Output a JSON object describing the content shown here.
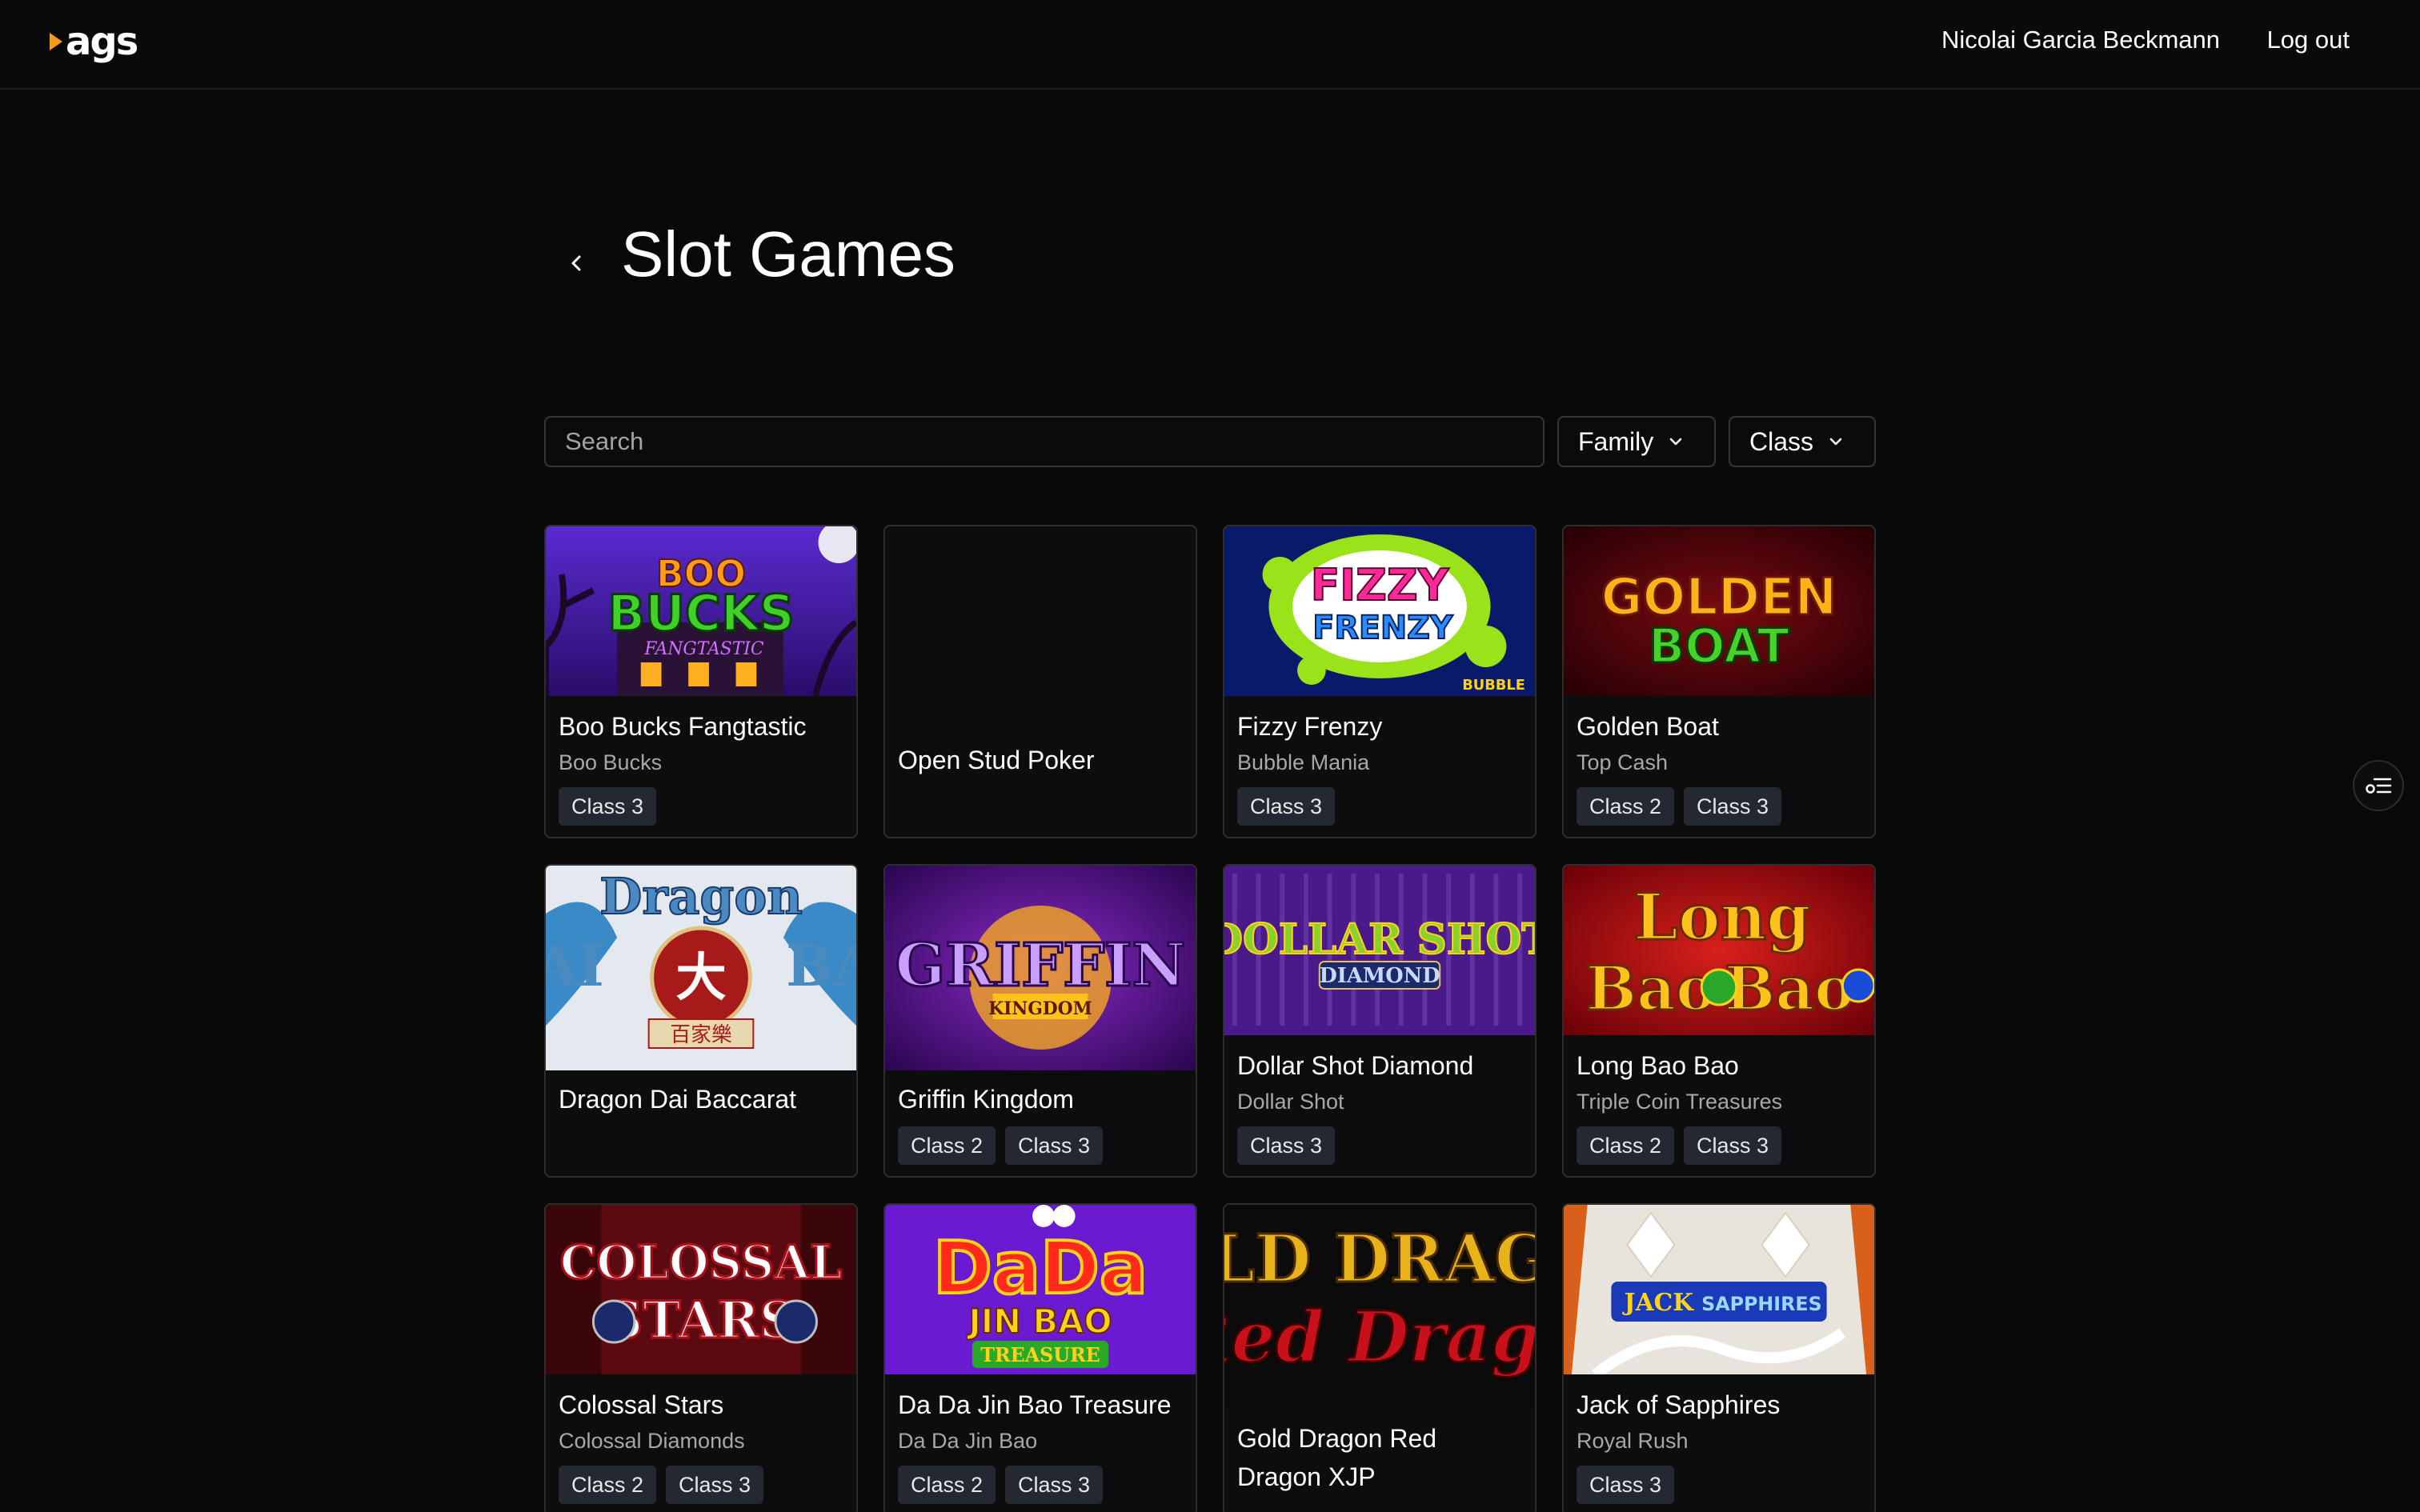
{
  "header": {
    "logo_text": "ags",
    "user_name": "Nicolai Garcia Beckmann",
    "logout_label": "Log out"
  },
  "page": {
    "title": "Slot Games"
  },
  "filters": {
    "search_placeholder": "Search",
    "family_label": "Family",
    "class_label": "Class"
  },
  "games": [
    {
      "title": "Boo Bucks Fangtastic",
      "family": "Boo Bucks",
      "classes": [
        "Class 3"
      ],
      "art_text": [
        "BOO",
        "BUCKS",
        "FANGTASTIC"
      ]
    },
    {
      "title": "Open Stud Poker",
      "family": "",
      "classes": [],
      "art_text": []
    },
    {
      "title": "Fizzy Frenzy",
      "family": "Bubble Mania",
      "classes": [
        "Class 3"
      ],
      "art_text": [
        "FIZZY",
        "FRENZY",
        "BUBBLE"
      ]
    },
    {
      "title": "Golden Boat",
      "family": "Top Cash",
      "classes": [
        "Class 2",
        "Class 3"
      ],
      "art_text": [
        "GOLDEN",
        "BOAT"
      ]
    },
    {
      "title": "Dragon Dai Baccarat",
      "family": "",
      "classes": [],
      "art_text": [
        "Dragon",
        "AI",
        "BA",
        "大",
        "百家樂"
      ]
    },
    {
      "title": "Griffin Kingdom",
      "family": "",
      "classes": [
        "Class 2",
        "Class 3"
      ],
      "art_text": [
        "GRIFFIN",
        "KINGDOM"
      ]
    },
    {
      "title": "Dollar Shot Diamond",
      "family": "Dollar Shot",
      "classes": [
        "Class 3"
      ],
      "art_text": [
        "DOLLAR SHOT",
        "DIAMOND"
      ]
    },
    {
      "title": "Long Bao Bao",
      "family": "Triple Coin Treasures",
      "classes": [
        "Class 2",
        "Class 3"
      ],
      "art_text": [
        "Long",
        "Bao",
        "Bao"
      ]
    },
    {
      "title": "Colossal Stars",
      "family": "Colossal Diamonds",
      "classes": [
        "Class 2",
        "Class 3"
      ],
      "art_text": [
        "COLOSSAL",
        "STARS"
      ]
    },
    {
      "title": "Da Da Jin Bao Treasure",
      "family": "Da Da Jin Bao",
      "classes": [
        "Class 2",
        "Class 3"
      ],
      "art_text": [
        "DaDa",
        "JIN BAO",
        "TREASURE"
      ]
    },
    {
      "title": "Gold Dragon Red Dragon XJP",
      "family": "",
      "classes": [],
      "art_text": [
        "LD DRAG",
        "Red Drago"
      ]
    },
    {
      "title": "Jack of Sapphires",
      "family": "Royal Rush",
      "classes": [
        "Class 3"
      ],
      "art_text": [
        "JACK",
        "SAPPHIRES"
      ]
    }
  ],
  "colors": {
    "background": "#090909",
    "card_border": "#2e2e2e",
    "badge_bg": "#232833",
    "logo_accent": "#f59b1c"
  }
}
